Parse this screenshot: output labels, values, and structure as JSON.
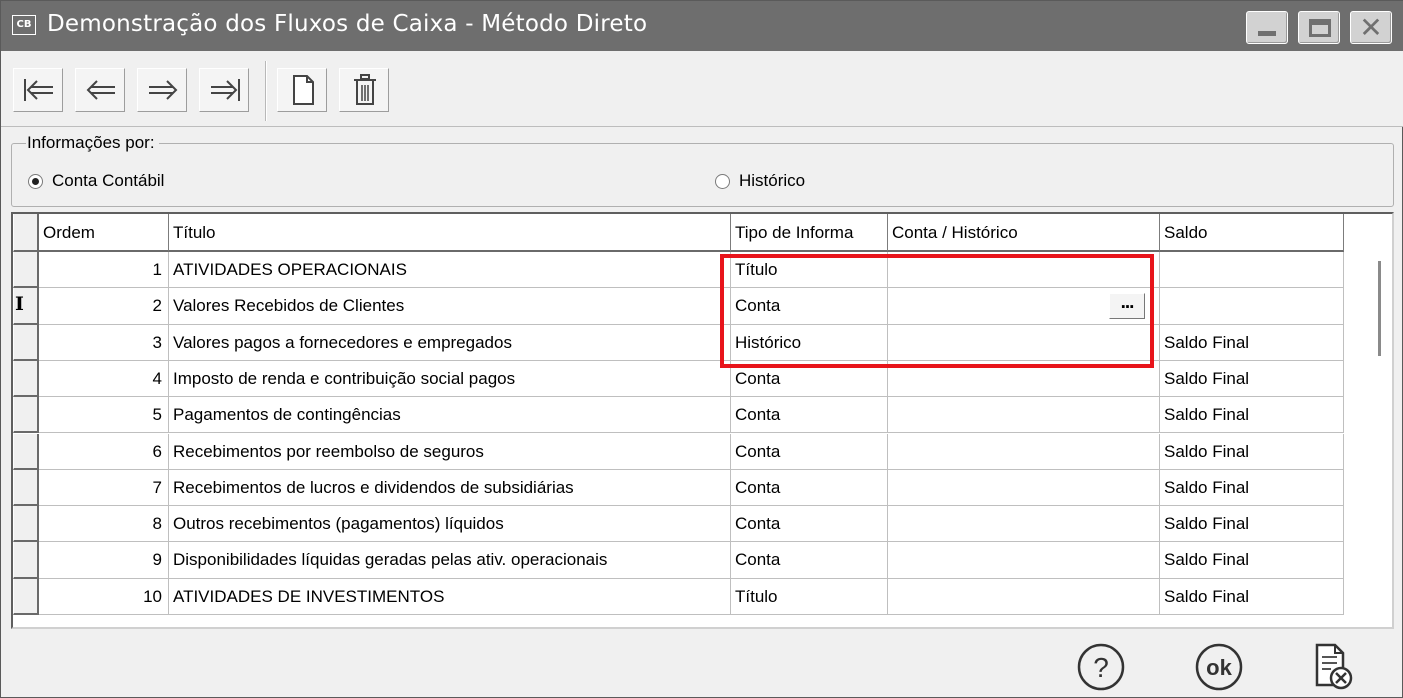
{
  "window": {
    "app_icon_text": "CB",
    "title": "Demonstração dos Fluxos de Caixa - Método Direto"
  },
  "toolbar": {
    "buttons": [
      "first-record-icon",
      "previous-record-icon",
      "next-record-icon",
      "last-record-icon",
      "new-document-icon",
      "delete-trash-icon"
    ]
  },
  "info_group": {
    "label": "Informações por:",
    "options": [
      {
        "label": "Conta Contábil",
        "selected": true
      },
      {
        "label": "Histórico",
        "selected": false
      }
    ]
  },
  "grid": {
    "headers": [
      "Ordem",
      "Título",
      "Tipo de Informa",
      "Conta / Histórico",
      "Saldo"
    ],
    "rows": [
      {
        "ordem": "1",
        "titulo": "ATIVIDADES OPERACIONAIS",
        "tipo": "Título",
        "conta": "",
        "saldo": ""
      },
      {
        "ordem": "2",
        "titulo": "Valores Recebidos de Clientes",
        "tipo": "Conta",
        "conta": "",
        "saldo": ""
      },
      {
        "ordem": "3",
        "titulo": "Valores pagos a fornecedores e empregados",
        "tipo": "Histórico",
        "conta": "",
        "saldo": "Saldo Final"
      },
      {
        "ordem": "4",
        "titulo": "Imposto de renda e contribuição social pagos",
        "tipo": "Conta",
        "conta": "",
        "saldo": "Saldo Final"
      },
      {
        "ordem": "5",
        "titulo": "Pagamentos de contingências",
        "tipo": "Conta",
        "conta": "",
        "saldo": "Saldo Final"
      },
      {
        "ordem": "6",
        "titulo": "Recebimentos por reembolso de seguros",
        "tipo": "Conta",
        "conta": "",
        "saldo": "Saldo Final"
      },
      {
        "ordem": "7",
        "titulo": "Recebimentos de lucros e dividendos de subsidiárias",
        "tipo": "Conta",
        "conta": "",
        "saldo": "Saldo Final"
      },
      {
        "ordem": "8",
        "titulo": "Outros recebimentos (pagamentos) líquidos",
        "tipo": "Conta",
        "conta": "",
        "saldo": "Saldo Final"
      },
      {
        "ordem": "9",
        "titulo": "Disponibilidades líquidas geradas pelas ativ. operacionais",
        "tipo": "Conta",
        "conta": "",
        "saldo": "Saldo Final"
      },
      {
        "ordem": "10",
        "titulo": "ATIVIDADES DE INVESTIMENTOS",
        "tipo": "Título",
        "conta": "",
        "saldo": "Saldo Final"
      }
    ],
    "current_row_marker": "I",
    "lookup_button": "...",
    "highlight_color": "#e8141b"
  },
  "footer": {
    "help_label": "?",
    "ok_label": "ok",
    "cancel_icon": "cancel-document-icon"
  }
}
